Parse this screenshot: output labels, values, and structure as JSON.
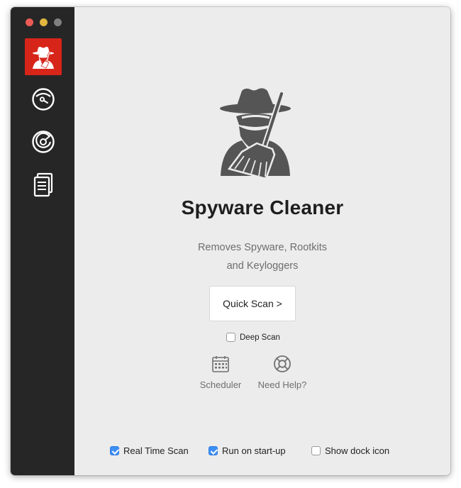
{
  "app": {
    "title": "Spyware Cleaner",
    "subtitle_line1": "Removes Spyware, Rootkits",
    "subtitle_line2": "and Keyloggers"
  },
  "sidebar": {
    "items": [
      {
        "icon": "spy-icon",
        "active": true
      },
      {
        "icon": "dashboard-gauge-icon",
        "active": false
      },
      {
        "icon": "radar-scan-icon",
        "active": false
      },
      {
        "icon": "log-documents-icon",
        "active": false
      }
    ]
  },
  "actions": {
    "quick_scan_label": "Quick Scan >",
    "deep_scan_label": "Deep Scan",
    "deep_scan_checked": false
  },
  "tools": {
    "scheduler_label": "Scheduler",
    "help_label": "Need Help?"
  },
  "options": {
    "real_time_label": "Real Time Scan",
    "real_time_checked": true,
    "startup_label": "Run on start-up",
    "startup_checked": true,
    "dock_label": "Show dock icon",
    "dock_checked": false
  },
  "colors": {
    "accent": "#d7251a",
    "sidebar": "#262626",
    "checkbox": "#3d8ef5",
    "background": "#ececec"
  }
}
